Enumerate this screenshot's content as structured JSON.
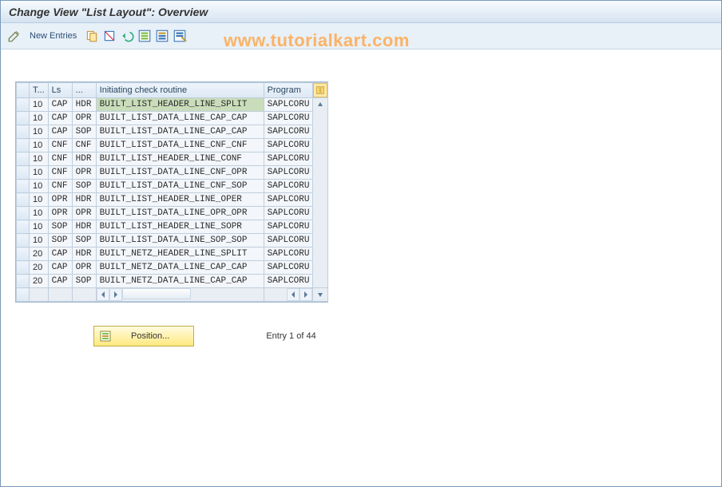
{
  "title": "Change View \"List Layout\": Overview",
  "watermark": "www.tutorialkart.com",
  "toolbar": {
    "new_entries": "New Entries"
  },
  "columns": {
    "sel": "",
    "t": "T...",
    "ls": "Ls",
    "dots": "...",
    "routine": "Initiating check routine",
    "program": "Program"
  },
  "rows": [
    {
      "t": "10",
      "ls": "CAP",
      "d": "HDR",
      "r": "BUILT_LIST_HEADER_LINE_SPLIT",
      "p": "SAPLCORU",
      "sel": true
    },
    {
      "t": "10",
      "ls": "CAP",
      "d": "OPR",
      "r": "BUILT_LIST_DATA_LINE_CAP_CAP",
      "p": "SAPLCORU"
    },
    {
      "t": "10",
      "ls": "CAP",
      "d": "SOP",
      "r": "BUILT_LIST_DATA_LINE_CAP_CAP",
      "p": "SAPLCORU"
    },
    {
      "t": "10",
      "ls": "CNF",
      "d": "CNF",
      "r": "BUILT_LIST_DATA_LINE_CNF_CNF",
      "p": "SAPLCORU"
    },
    {
      "t": "10",
      "ls": "CNF",
      "d": "HDR",
      "r": "BUILT_LIST_HEADER_LINE_CONF",
      "p": "SAPLCORU"
    },
    {
      "t": "10",
      "ls": "CNF",
      "d": "OPR",
      "r": "BUILT_LIST_DATA_LINE_CNF_OPR",
      "p": "SAPLCORU"
    },
    {
      "t": "10",
      "ls": "CNF",
      "d": "SOP",
      "r": "BUILT_LIST_DATA_LINE_CNF_SOP",
      "p": "SAPLCORU"
    },
    {
      "t": "10",
      "ls": "OPR",
      "d": "HDR",
      "r": "BUILT_LIST_HEADER_LINE_OPER",
      "p": "SAPLCORU"
    },
    {
      "t": "10",
      "ls": "OPR",
      "d": "OPR",
      "r": "BUILT_LIST_DATA_LINE_OPR_OPR",
      "p": "SAPLCORU"
    },
    {
      "t": "10",
      "ls": "SOP",
      "d": "HDR",
      "r": "BUILT_LIST_HEADER_LINE_SOPR",
      "p": "SAPLCORU"
    },
    {
      "t": "10",
      "ls": "SOP",
      "d": "SOP",
      "r": "BUILT_LIST_DATA_LINE_SOP_SOP",
      "p": "SAPLCORU"
    },
    {
      "t": "20",
      "ls": "CAP",
      "d": "HDR",
      "r": "BUILT_NETZ_HEADER_LINE_SPLIT",
      "p": "SAPLCORU"
    },
    {
      "t": "20",
      "ls": "CAP",
      "d": "OPR",
      "r": "BUILT_NETZ_DATA_LINE_CAP_CAP",
      "p": "SAPLCORU"
    },
    {
      "t": "20",
      "ls": "CAP",
      "d": "SOP",
      "r": "BUILT_NETZ_DATA_LINE_CAP_CAP",
      "p": "SAPLCORU"
    }
  ],
  "position_btn": "Position...",
  "entry_text": "Entry 1 of 44"
}
